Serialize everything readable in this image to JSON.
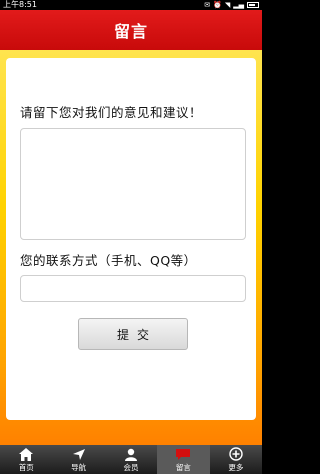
{
  "status_bar": {
    "time": "上午8:51"
  },
  "header": {
    "title": "留言"
  },
  "form": {
    "prompt": "请留下您对我们的意见和建议！",
    "contact_label": "您的联系方式（手机、QQ等）",
    "submit_label": "提交"
  },
  "tabs": [
    {
      "label": "首页",
      "icon": "home-icon"
    },
    {
      "label": "导航",
      "icon": "navigation-icon"
    },
    {
      "label": "会员",
      "icon": "member-icon"
    },
    {
      "label": "留言",
      "icon": "message-icon",
      "active": true
    },
    {
      "label": "更多",
      "icon": "more-icon"
    }
  ],
  "colors": {
    "header": "#d40f0f",
    "background_top": "#ffe44f",
    "background_bottom": "#ff8100",
    "active_icon": "#d40f0f"
  }
}
